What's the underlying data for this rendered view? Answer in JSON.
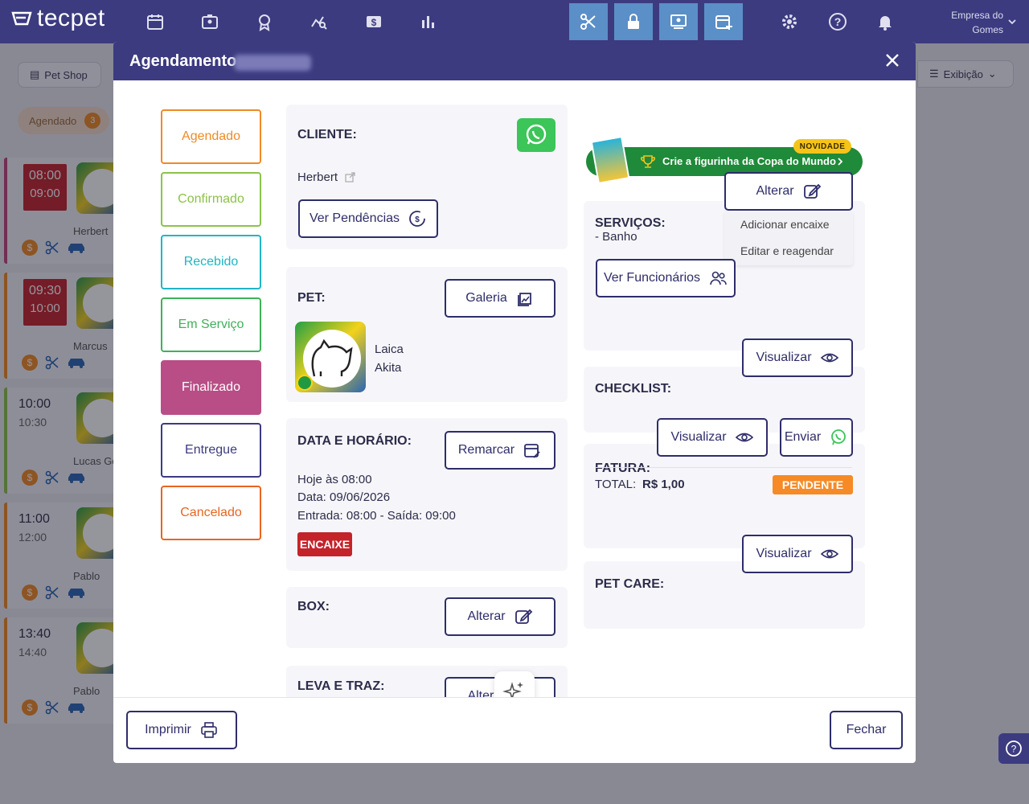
{
  "app": {
    "logo_text": "tecpet",
    "company_line1": "Empresa do",
    "company_line2": "Gomes"
  },
  "nav": {
    "icons": [
      "calendar-icon",
      "id-card-icon",
      "award-icon",
      "analytics-icon",
      "dollar-icon",
      "bar-chart-icon"
    ],
    "highlight_icons": [
      "scissors-icon",
      "lock-icon",
      "monitor-icon",
      "calendar-add-icon"
    ],
    "right_icons": [
      "gear-icon",
      "help-icon",
      "bell-icon"
    ]
  },
  "background": {
    "petshop_label": "Pet Shop",
    "exibicao_label": "Exibição",
    "status_label": "Agendado",
    "status_count": "3",
    "cards": [
      {
        "start": "08:00",
        "end": "09:00",
        "name": "Herbert",
        "color": "#c0467a",
        "red": true
      },
      {
        "start": "09:30",
        "end": "10:00",
        "name": "Marcus",
        "color": "#f08a24",
        "red": true
      },
      {
        "start": "10:00",
        "end": "10:30",
        "name": "Lucas Go",
        "color": "#8bc34a",
        "red": false
      },
      {
        "start": "11:00",
        "end": "12:00",
        "name": "Pablo",
        "color": "#f08a24",
        "red": false
      },
      {
        "start": "13:40",
        "end": "14:40",
        "name": "Pablo",
        "color": "#f08a24",
        "red": false
      }
    ]
  },
  "modal": {
    "title": "Agendamento",
    "status_buttons": [
      {
        "label": "Agendado",
        "color": "#f08a24",
        "active": false
      },
      {
        "label": "Confirmado",
        "color": "#8bc34a",
        "active": false
      },
      {
        "label": "Recebido",
        "color": "#1fb6c4",
        "active": false
      },
      {
        "label": "Em Serviço",
        "color": "#3fb15a",
        "active": false
      },
      {
        "label": "Finalizado",
        "color": "#b94d86",
        "active": true
      },
      {
        "label": "Entregue",
        "color": "#3c3b80",
        "active": false
      },
      {
        "label": "Cancelado",
        "color": "#e8651f",
        "active": false
      }
    ],
    "cliente": {
      "label": "CLIENTE:",
      "name": "Herbert",
      "pendencias_button": "Ver Pendências"
    },
    "pet": {
      "label": "PET:",
      "galeria_button": "Galeria",
      "name": "Laica",
      "breed": "Akita"
    },
    "data": {
      "label": "DATA E HORÁRIO:",
      "remarcar_button": "Remarcar",
      "line1": "Hoje às 08:00",
      "line2": "Data: 09/06/2026",
      "line3": "Entrada: 08:00 - Saída: 09:00",
      "badge": "ENCAIXE"
    },
    "box": {
      "label": "BOX:",
      "alterar_button": "Alterar"
    },
    "leva": {
      "label": "LEVA E TRAZ:",
      "alterar_button": "Alterar"
    },
    "promo": {
      "text": "Crie a figurinha da Copa do Mundo",
      "tag": "NOVIDADE"
    },
    "servicos": {
      "label": "SERVIÇOS:",
      "alterar_button": "Alterar",
      "item": "- Banho",
      "funcionarios_button": "Ver Funcionários",
      "dropdown": [
        "Adicionar encaixe",
        "Editar e reagendar"
      ]
    },
    "checklist": {
      "label": "CHECKLIST:",
      "visualizar_button": "Visualizar"
    },
    "fatura": {
      "label": "FATURA:",
      "visualizar_button": "Visualizar",
      "enviar_button": "Enviar",
      "total_label": "TOTAL:",
      "total_value": "R$ 1,00",
      "status": "PENDENTE"
    },
    "petcare": {
      "label": "PET CARE:",
      "visualizar_button": "Visualizar"
    },
    "footer": {
      "imprimir_button": "Imprimir",
      "fechar_button": "Fechar"
    }
  },
  "colors": {
    "primary": "#3c3b80",
    "accent_blue": "#5b8fc7",
    "whatsapp": "#3cc558",
    "encaixe": "#c4232a",
    "pendente": "#f58a27"
  }
}
